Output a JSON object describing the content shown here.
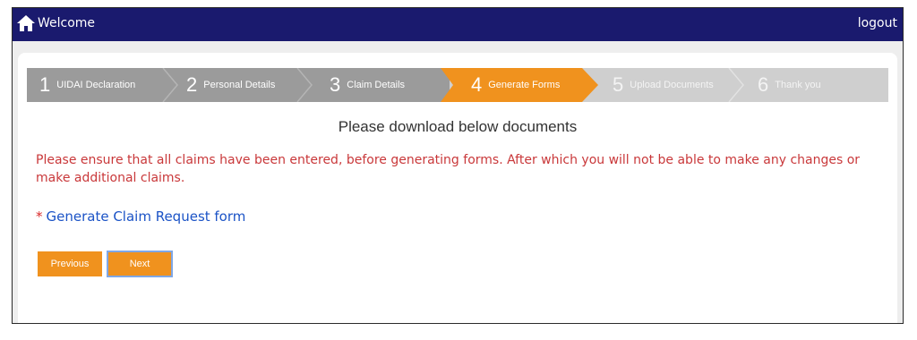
{
  "header": {
    "title": "Welcome",
    "logout_label": "logout",
    "home_icon": "home-icon"
  },
  "stepper": {
    "steps": [
      {
        "number": "1",
        "label": "UIDAI Declaration",
        "state": "done"
      },
      {
        "number": "2",
        "label": "Personal Details",
        "state": "done"
      },
      {
        "number": "3",
        "label": "Claim Details",
        "state": "done"
      },
      {
        "number": "4",
        "label": "Generate Forms",
        "state": "active"
      },
      {
        "number": "5",
        "label": "Upload Documents",
        "state": "future"
      },
      {
        "number": "6",
        "label": "Thank you",
        "state": "future"
      }
    ]
  },
  "main": {
    "heading": "Please download below documents",
    "warning": "Please ensure that all claims have been entered, before generating forms. After which you will not be able to make any changes or make additional claims.",
    "required_mark": "*",
    "generate_link": "Generate Claim Request form",
    "previous_label": "Previous",
    "next_label": "Next"
  },
  "colors": {
    "topbar": "#1a1a6e",
    "stepper_done": "#9b9b9b",
    "stepper_active": "#f0921e",
    "stepper_future": "#cfcfcf",
    "button": "#f0921e",
    "warning_text": "#c9383a",
    "link": "#1b53c6"
  }
}
